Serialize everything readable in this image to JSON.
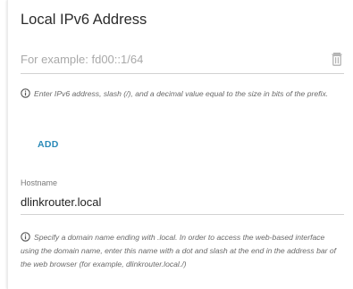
{
  "ipv6_section": {
    "title": "Local IPv6 Address",
    "input": {
      "value": "",
      "placeholder": "For example: fd00::1/64"
    },
    "delete_icon": "trash-icon",
    "hint": "Enter IPv6 address, slash (/), and a decimal value equal to the size in bits of the prefix.",
    "add_label": "ADD"
  },
  "hostname": {
    "label": "Hostname",
    "value": "dlinkrouter.local",
    "hint": "Specify a domain name ending with .local. In order to access the web-based interface using the domain name, enter this name with a dot and slash at the end in the address bar of the web browser (for example, dlinkrouter.local./)"
  },
  "colors": {
    "accent": "#2a8ab8",
    "text": "#333333",
    "hint": "#6a6a6a",
    "underline": "#d2d2d2"
  }
}
